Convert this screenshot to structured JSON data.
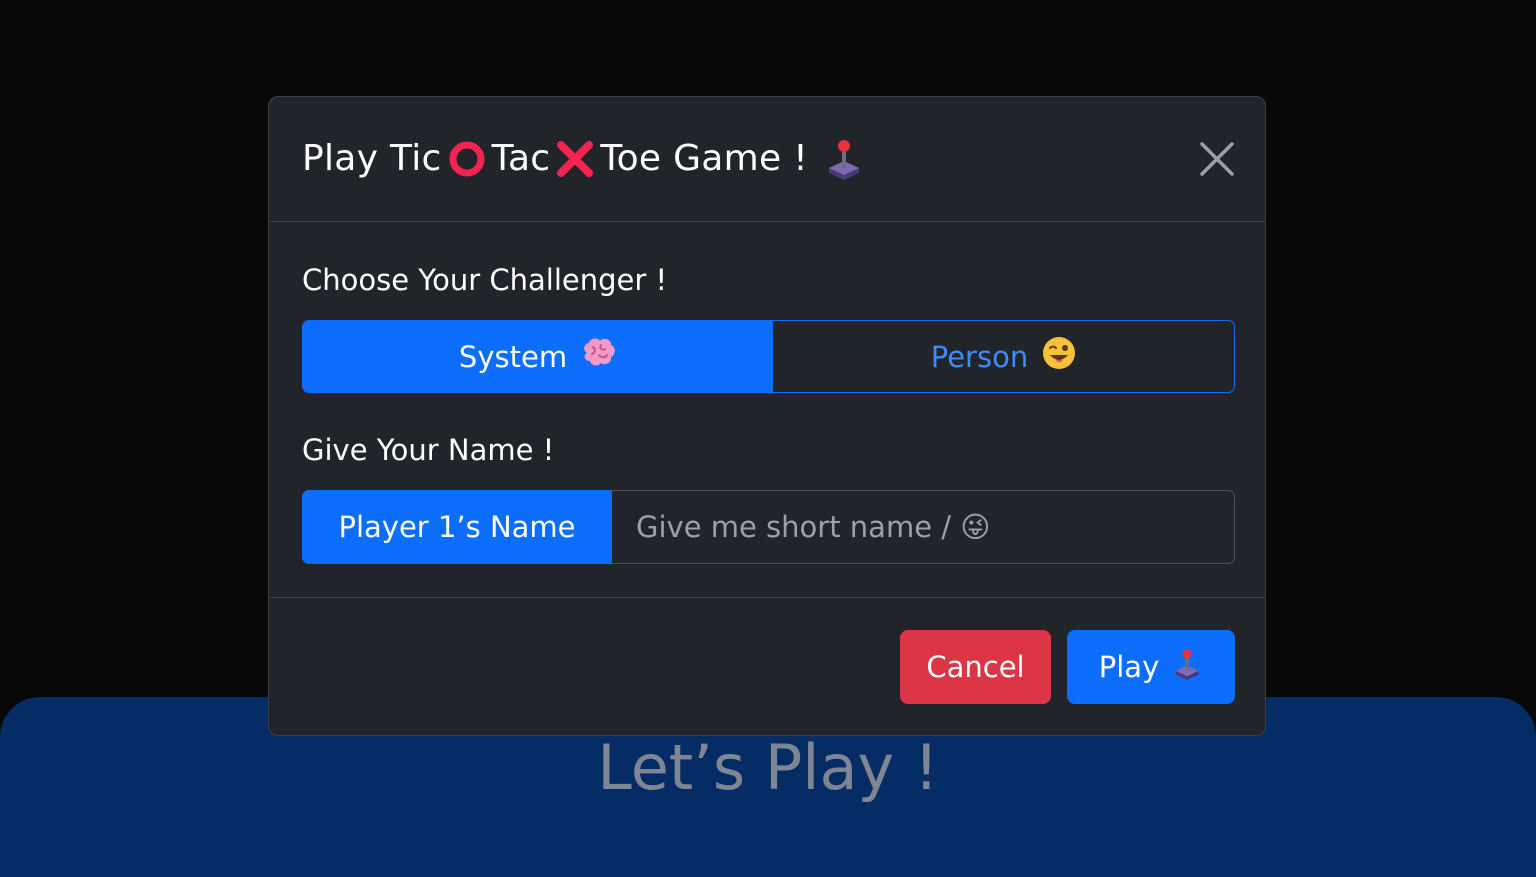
{
  "background": {
    "title": "Let’s Play !"
  },
  "modal": {
    "title": {
      "part1": "Play Tic",
      "part2": "Tac",
      "part3": "Toe Game !",
      "icons": [
        "circle-o-icon",
        "cross-x-icon",
        "joystick-icon"
      ]
    },
    "close_label": "Close",
    "challenger": {
      "label": "Choose Your Challenger !",
      "options": [
        {
          "label": "System",
          "icon": "brain-icon",
          "selected": true
        },
        {
          "label": "Person",
          "icon": "winking-face-icon",
          "selected": false
        }
      ]
    },
    "name": {
      "label": "Give Your Name !",
      "prefix": "Player 1’s Name",
      "placeholder": "Give me short name / 😜",
      "value": ""
    },
    "footer": {
      "cancel_label": "Cancel",
      "play_label": "Play",
      "play_icon": "joystick-icon"
    }
  },
  "colors": {
    "primary": "#0d6efd",
    "danger": "#dc3545",
    "modal_bg": "#212529",
    "page_bg": "#080808",
    "accent_red": "#f4234f"
  }
}
